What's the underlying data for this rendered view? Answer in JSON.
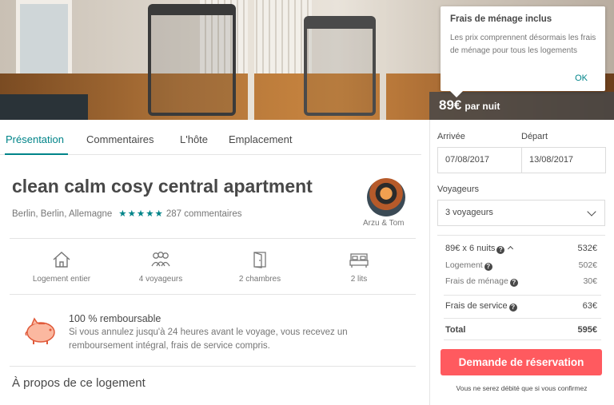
{
  "hero": {
    "price_amount": "89€",
    "price_unit": "par nuit"
  },
  "tooltip": {
    "title": "Frais de ménage inclus",
    "body": "Les prix comprennent désormais les frais de ménage pour tous les logements",
    "ok": "OK"
  },
  "tabs": [
    {
      "label": "Présentation",
      "active": true
    },
    {
      "label": "Commentaires",
      "active": false
    },
    {
      "label": "L'hôte",
      "active": false
    },
    {
      "label": "Emplacement",
      "active": false
    }
  ],
  "listing": {
    "title": "clean calm cosy central apartment",
    "location": "Berlin, Berlin, Allemagne",
    "stars": "★★★★★",
    "reviews": "287 commentaires",
    "host": "Arzu & Tom"
  },
  "amenities": [
    {
      "icon": "home-icon",
      "label": "Logement entier"
    },
    {
      "icon": "guests-icon",
      "label": "4 voyageurs"
    },
    {
      "icon": "door-icon",
      "label": "2 chambres"
    },
    {
      "icon": "bed-icon",
      "label": "2 lits"
    }
  ],
  "refund": {
    "title": "100 % remboursable",
    "text": "Si vous annulez jusqu'à 24 heures avant le voyage, vous recevez un remboursement intégral, frais de service compris."
  },
  "about": "À propos de ce logement",
  "booking": {
    "arrival_label": "Arrivée",
    "departure_label": "Départ",
    "arrival_date": "07/08/2017",
    "departure_date": "13/08/2017",
    "guests_label": "Voyageurs",
    "guests_value": "3 voyageurs",
    "nights_line": "89€ x 6 nuits",
    "nights_total": "532€",
    "lodging_label": "Logement",
    "lodging_value": "502€",
    "cleaning_label": "Frais de ménage",
    "cleaning_value": "30€",
    "service_label": "Frais de service",
    "service_value": "63€",
    "total_label": "Total",
    "total_value": "595€",
    "button": "Demande de réservation",
    "note": "Vous ne serez débité que si vous confirmez"
  },
  "colors": {
    "accent": "#008489",
    "book_button": "#ff5a5f",
    "text": "#484848"
  }
}
